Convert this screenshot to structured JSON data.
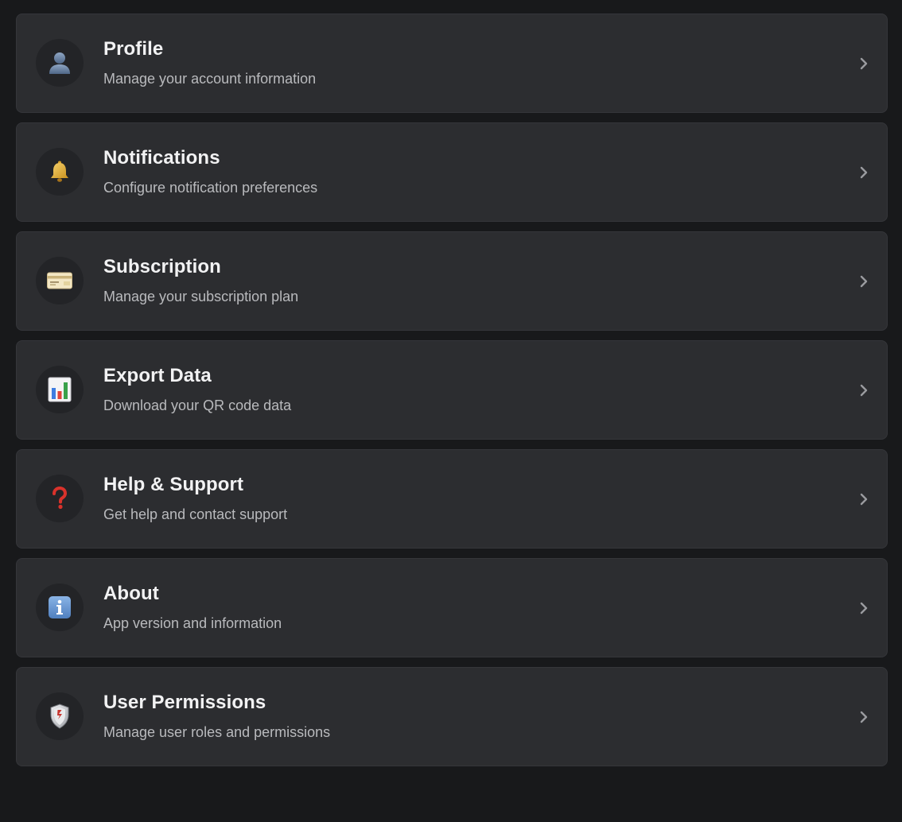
{
  "settings": {
    "items": [
      {
        "title": "Profile",
        "description": "Manage your account information",
        "icon": "person-silhouette-icon"
      },
      {
        "title": "Notifications",
        "description": "Configure notification preferences",
        "icon": "bell-icon"
      },
      {
        "title": "Subscription",
        "description": "Manage your subscription plan",
        "icon": "credit-card-icon"
      },
      {
        "title": "Export Data",
        "description": "Download your QR code data",
        "icon": "bar-chart-icon"
      },
      {
        "title": "Help & Support",
        "description": "Get help and contact support",
        "icon": "question-mark-icon"
      },
      {
        "title": "About",
        "description": "App version and information",
        "icon": "info-icon"
      },
      {
        "title": "User Permissions",
        "description": "Manage user roles and permissions",
        "icon": "shield-icon"
      }
    ]
  },
  "colors": {
    "background": "#18191b",
    "card": "#2c2d30",
    "title_text": "#f2f2f3",
    "description_text": "#b9babd",
    "chevron": "#9a9b9f"
  }
}
